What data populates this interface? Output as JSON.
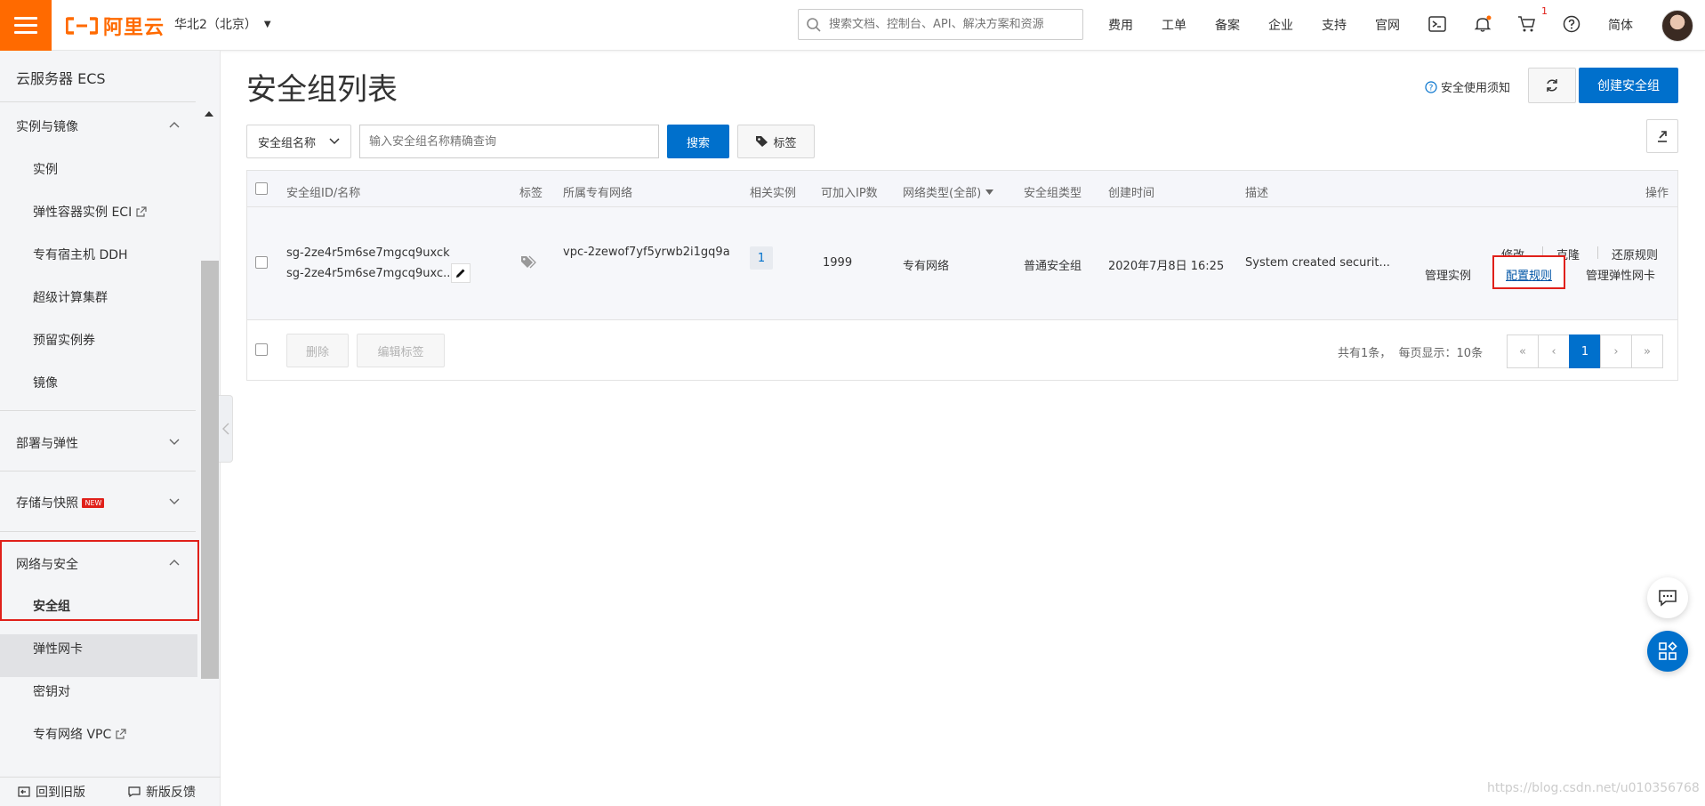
{
  "header": {
    "logo_text": "阿里云",
    "region": "华北2（北京）",
    "search_placeholder": "搜索文档、控制台、API、解决方案和资源",
    "nav": [
      "费用",
      "工单",
      "备案",
      "企业",
      "支持",
      "官网"
    ],
    "cart_badge": "1",
    "language": "简体",
    "accent": "#ff6a00"
  },
  "sidebar": {
    "title": "云服务器 ECS",
    "group_instances": "实例与镜像",
    "items_instances": [
      "实例",
      "弹性容器实例 ECI",
      "专有宿主机 DDH",
      "超级计算集群",
      "预留实例券",
      "镜像"
    ],
    "group_deploy": "部署与弹性",
    "group_storage": "存储与快照",
    "new_badge": "NEW",
    "group_network": "网络与安全",
    "items_network": [
      "安全组",
      "弹性网卡",
      "密钥对",
      "专有网络 VPC"
    ],
    "back_old": "回到旧版",
    "feedback": "新版反馈"
  },
  "main": {
    "title": "安全组列表",
    "notice_link": "安全使用须知",
    "create_button": "创建安全组",
    "filter_select": "安全组名称",
    "filter_placeholder": "输入安全组名称精确查询",
    "search_button": "搜索",
    "tag_button": "标签",
    "columns": [
      "安全组ID/名称",
      "标签",
      "所属专有网络",
      "相关实例",
      "可加入IP数",
      "网络类型(全部)",
      "安全组类型",
      "创建时间",
      "描述",
      "操作"
    ],
    "row": {
      "id": "sg-2ze4r5m6se7mgcq9uxck",
      "name": "sg-2ze4r5m6se7mgcq9uxc...",
      "vpc": "vpc-2zewof7yf5yrwb2i1gq9a",
      "instances": "1",
      "ip_count": "1999",
      "net_type": "专有网络",
      "sg_type": "普通安全组",
      "created": "2020年7月8日 16:25",
      "desc": "System created securit...",
      "ops_top": [
        "修改",
        "克隆",
        "还原规则"
      ],
      "ops_bottom": [
        "管理实例",
        "配置规则",
        "管理弹性网卡"
      ]
    },
    "delete_button": "删除",
    "edit_tags_button": "编辑标签",
    "total_text": "共有1条，  每页显示：10条",
    "pager": [
      "«",
      "‹",
      "1",
      "›",
      "»"
    ]
  },
  "watermark": "https://blog.csdn.net/u010356768"
}
